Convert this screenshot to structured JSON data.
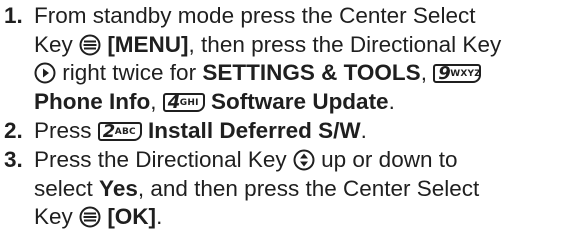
{
  "steps": [
    {
      "number": "1.",
      "t1": "From standby mode press the Center Select",
      "t2": "Key",
      "menu": "[MENU]",
      "t3": ", then press the Directional Key",
      "t4": "right twice for",
      "settings": "SETTINGS & TOOLS",
      "comma": ",",
      "key9_digit": "9",
      "key9_letters": "WXYZ",
      "phone_info": "Phone Info",
      "key4_digit": "4",
      "key4_letters": "GHI",
      "software_update": "Software Update",
      "period": "."
    },
    {
      "number": "2.",
      "t1": "Press",
      "key2_digit": "2",
      "key2_letters": "ABC",
      "install": "Install Deferred S/W",
      "period": "."
    },
    {
      "number": "3.",
      "t1": "Press the Directional Key",
      "t2": "up or down to",
      "t3": "select",
      "yes": "Yes",
      "t4": ", and then press the Center Select",
      "t5": "Key",
      "ok": "[OK]",
      "period": "."
    }
  ],
  "icons": {
    "center_select": "center-select-key-icon",
    "directional_right": "directional-key-right-icon",
    "directional_updown": "directional-key-up-down-icon",
    "keypad": "keypad-key-icon"
  }
}
